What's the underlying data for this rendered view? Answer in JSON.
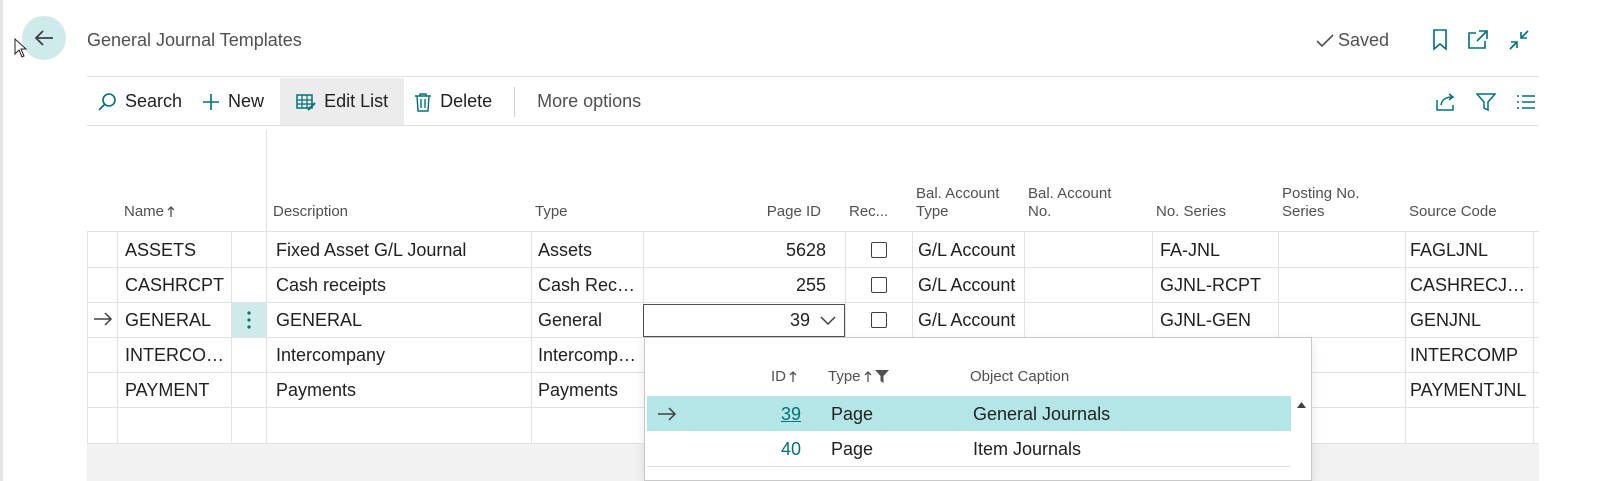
{
  "page": {
    "title": "General Journal Templates",
    "saved_label": "Saved"
  },
  "actions": {
    "search": "Search",
    "new": "New",
    "edit_list": "Edit List",
    "delete": "Delete",
    "more_options": "More options"
  },
  "columns": {
    "name": "Name",
    "description": "Description",
    "type": "Type",
    "page_id": "Page ID",
    "recurring": "Rec...",
    "bal_account_type": [
      "Bal. Account",
      "Type"
    ],
    "bal_account_no": [
      "Bal. Account",
      "No."
    ],
    "no_series": "No. Series",
    "posting_no_series": [
      "Posting No.",
      "Series"
    ],
    "source_code": "Source Code"
  },
  "rows": [
    {
      "name": "ASSETS",
      "description": "Fixed Asset G/L Journal",
      "type": "Assets",
      "page_id": "5628",
      "bal_type": "G/L Account",
      "no_series": "FA-JNL",
      "source_code": "FAGLJNL"
    },
    {
      "name": "CASHRCPT",
      "description": "Cash receipts",
      "type": "Cash Recei...",
      "page_id": "255",
      "bal_type": "G/L Account",
      "no_series": "GJNL-RCPT",
      "source_code": "CASHRECJNL"
    },
    {
      "name": "GENERAL",
      "description": "GENERAL",
      "type": "General",
      "page_id": "39",
      "bal_type": "G/L Account",
      "no_series": "GJNL-GEN",
      "source_code": "GENJNL"
    },
    {
      "name": "INTERCOMP",
      "description": "Intercompany",
      "type": "Intercompa...",
      "source_code": "INTERCOMP"
    },
    {
      "name": "PAYMENT",
      "description": "Payments",
      "type": "Payments",
      "source_code": "PAYMENTJNL"
    }
  ],
  "lookup": {
    "headers": {
      "id": "ID",
      "type": "Type",
      "caption": "Object Caption"
    },
    "rows": [
      {
        "id": "39",
        "type": "Page",
        "caption": "General Journals"
      },
      {
        "id": "40",
        "type": "Page",
        "caption": "Item Journals"
      }
    ]
  },
  "colors": {
    "accent": "#00707a",
    "selection": "#b4e6e8",
    "back_button": "#cfeaea"
  },
  "icons": [
    "back-arrow-icon",
    "checkmark-icon",
    "bookmark-icon",
    "open-new-window-icon",
    "collapse-icon",
    "search-icon",
    "plus-icon",
    "edit-list-icon",
    "trash-icon",
    "share-icon",
    "filter-icon",
    "list-view-icon",
    "sort-ascending-icon",
    "row-arrow-icon",
    "more-vertical-icon",
    "chevron-down-icon",
    "scroll-up-icon"
  ]
}
